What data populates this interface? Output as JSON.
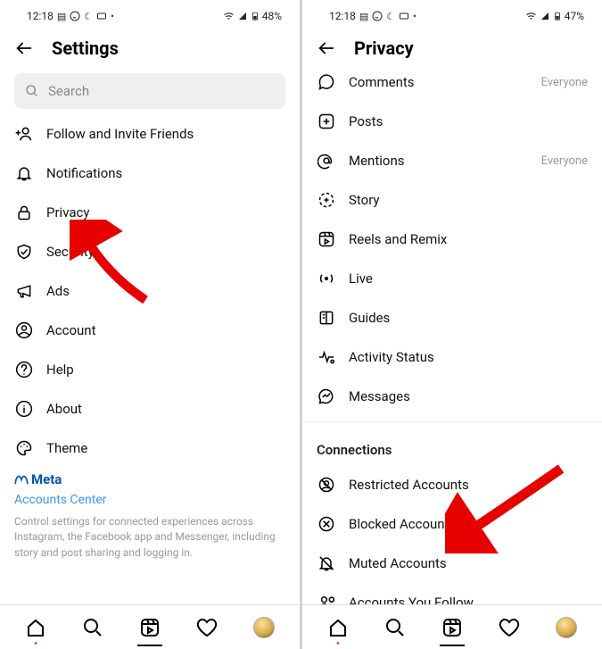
{
  "left": {
    "status": {
      "time": "12:18",
      "battery": "48%"
    },
    "title": "Settings",
    "search_placeholder": "Search",
    "items": [
      {
        "label": "Follow and Invite Friends"
      },
      {
        "label": "Notifications"
      },
      {
        "label": "Privacy"
      },
      {
        "label": "Security"
      },
      {
        "label": "Ads"
      },
      {
        "label": "Account"
      },
      {
        "label": "Help"
      },
      {
        "label": "About"
      },
      {
        "label": "Theme"
      }
    ],
    "meta_label": "Meta",
    "accounts_center": "Accounts Center",
    "helper": "Control settings for connected experiences across Instagram, the Facebook app and Messenger, including story and post sharing and logging in."
  },
  "right": {
    "status": {
      "time": "12:18",
      "battery": "47%"
    },
    "title": "Privacy",
    "items": [
      {
        "label": "Comments",
        "value": "Everyone"
      },
      {
        "label": "Posts"
      },
      {
        "label": "Mentions",
        "value": "Everyone"
      },
      {
        "label": "Story"
      },
      {
        "label": "Reels and Remix"
      },
      {
        "label": "Live"
      },
      {
        "label": "Guides"
      },
      {
        "label": "Activity Status"
      },
      {
        "label": "Messages"
      }
    ],
    "section": "Connections",
    "connections": [
      {
        "label": "Restricted Accounts"
      },
      {
        "label": "Blocked Accounts"
      },
      {
        "label": "Muted Accounts"
      },
      {
        "label": "Accounts You Follow"
      }
    ]
  }
}
